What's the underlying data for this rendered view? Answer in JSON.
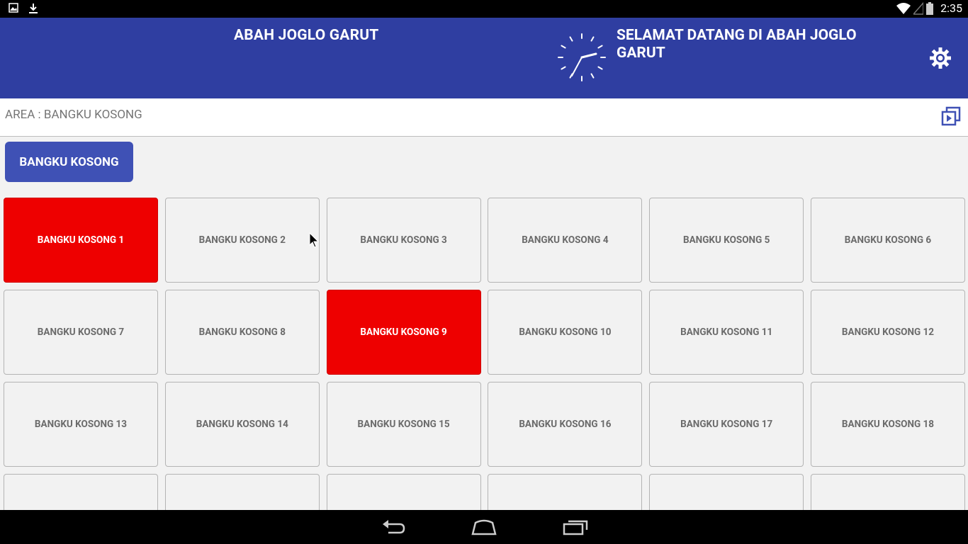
{
  "status_bar": {
    "time": "2:35",
    "left_icons": [
      "image-icon",
      "download-icon"
    ],
    "right_icons": [
      "wifi-icon",
      "signal-icon",
      "battery-icon"
    ]
  },
  "header": {
    "app_title": "ABAH JOGLO GARUT",
    "welcome_text": "SELAMAT DATANG DI ABAH JOGLO GARUT",
    "clock_icon": "analog-clock-icon",
    "settings_icon": "gear-icon",
    "background_color": "#2f3ea1"
  },
  "area_bar": {
    "label": "AREA : BANGKU KOSONG",
    "action_icon": "switch-area-icon"
  },
  "area_button": {
    "label": "BANGKU KOSONG",
    "color": "#3f51b5"
  },
  "seats": [
    {
      "label": "BANGKU KOSONG 1",
      "occupied": true
    },
    {
      "label": "BANGKU KOSONG 2",
      "occupied": false
    },
    {
      "label": "BANGKU KOSONG 3",
      "occupied": false
    },
    {
      "label": "BANGKU KOSONG 4",
      "occupied": false
    },
    {
      "label": "BANGKU KOSONG 5",
      "occupied": false
    },
    {
      "label": "BANGKU KOSONG 6",
      "occupied": false
    },
    {
      "label": "BANGKU KOSONG 7",
      "occupied": false
    },
    {
      "label": "BANGKU KOSONG 8",
      "occupied": false
    },
    {
      "label": "BANGKU KOSONG 9",
      "occupied": true
    },
    {
      "label": "BANGKU KOSONG 10",
      "occupied": false
    },
    {
      "label": "BANGKU KOSONG 11",
      "occupied": false
    },
    {
      "label": "BANGKU KOSONG 12",
      "occupied": false
    },
    {
      "label": "BANGKU KOSONG 13",
      "occupied": false
    },
    {
      "label": "BANGKU KOSONG 14",
      "occupied": false
    },
    {
      "label": "BANGKU KOSONG 15",
      "occupied": false
    },
    {
      "label": "BANGKU KOSONG 16",
      "occupied": false
    },
    {
      "label": "BANGKU KOSONG 17",
      "occupied": false
    },
    {
      "label": "BANGKU KOSONG 18",
      "occupied": false
    },
    {
      "label": "",
      "occupied": false
    },
    {
      "label": "",
      "occupied": false
    },
    {
      "label": "",
      "occupied": false
    },
    {
      "label": "",
      "occupied": false
    },
    {
      "label": "",
      "occupied": false
    },
    {
      "label": "",
      "occupied": false
    }
  ],
  "colors": {
    "occupied": "#ee0000",
    "available": "#f2f2f2"
  },
  "nav_bar": {
    "buttons": [
      "back-icon",
      "home-icon",
      "recent-apps-icon"
    ]
  }
}
